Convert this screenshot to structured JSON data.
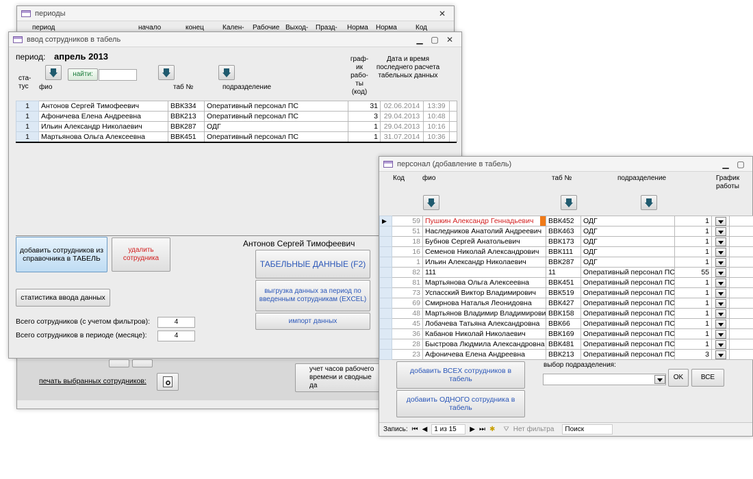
{
  "bg_window": {
    "title": "периоды",
    "headers": [
      "период",
      "начало",
      "конец",
      "Кален-",
      "Рабочие",
      "Выход-",
      "Празд-",
      "Норма",
      "Норма",
      "Код"
    ],
    "print_label": "печать выбранных сотрудников:",
    "hours_button": "учет часов рабочего времени и сводные да"
  },
  "main_window": {
    "title": "ввод сотрудников в табель",
    "period_label": "период:",
    "period_value": "апрель 2013",
    "status_header": "ста-\nтус",
    "fio_header": "фио",
    "find_button": "найти:",
    "find_value": "",
    "tab_header": "таб №",
    "dept_header": "подразделение",
    "schedule_header": "граф-\nик\nрабо-\nты\n(код)",
    "datetime_header": "Дата и время последнего расчета табельных данных",
    "rows": [
      {
        "status": "1",
        "fio": "Антонов Сергей Тимофеевич",
        "tab": "ВВК334",
        "dept": "Оперативный персонал ПС",
        "sched": "31",
        "date": "02.06.2014",
        "time": "13:39"
      },
      {
        "status": "1",
        "fio": "Афоничева Елена Андреевна",
        "tab": "ВВК213",
        "dept": "Оперативный персонал ПС",
        "sched": "3",
        "date": "29.04.2013",
        "time": "10:48"
      },
      {
        "status": "1",
        "fio": "Ильин Александр Николаевич",
        "tab": "ВВК287",
        "dept": "ОДГ",
        "sched": "1",
        "date": "29.04.2013",
        "time": "10:16"
      },
      {
        "status": "1",
        "fio": "Мартьянова Ольга Алексеевна",
        "tab": "ВВК451",
        "dept": "Оперативный персонал ПС",
        "sched": "1",
        "date": "31.07.2014",
        "time": "10:36"
      }
    ],
    "add_button": "добавить сотрудников из справочника в ТАБЕЛЬ",
    "delete_button": "удалить сотрудника",
    "current_employee": "Антонов Сергей Тимофеевич",
    "tabel_button": "ТАБЕЛЬНЫЕ ДАННЫЕ  (F2)",
    "export_button": "выгрузка данных за период по введенным сотрудникам (EXCEL)",
    "import_button": "импорт данных",
    "stats_button": "статистика ввода данных",
    "total_filtered_label": "Всего сотрудников (с учетом фильтров):",
    "total_filtered_value": "4",
    "total_period_label": "Всего сотрудников в периоде (месяце):",
    "total_period_value": "4"
  },
  "personnel_window": {
    "title": "персонал (добавление в табель)",
    "col_code": "Код",
    "col_fio": "фио",
    "col_tab": "таб №",
    "col_dept": "подразделение",
    "col_schedule": "График работы",
    "rows": [
      {
        "code": "59",
        "fio": "Пушкин Александр Геннадьевич",
        "tab": "ВВК452",
        "dept": "ОДГ",
        "sched": "1"
      },
      {
        "code": "51",
        "fio": "Наследников Анатолий Андреевич",
        "tab": "ВВК463",
        "dept": "ОДГ",
        "sched": "1"
      },
      {
        "code": "18",
        "fio": "Бубнов Сергей Анатольевич",
        "tab": "ВВК173",
        "dept": "ОДГ",
        "sched": "1"
      },
      {
        "code": "16",
        "fio": "Семенов Николай Александрович",
        "tab": "ВВК111",
        "dept": "ОДГ",
        "sched": "1"
      },
      {
        "code": "1",
        "fio": "Ильин Александр Николаевич",
        "tab": "ВВК287",
        "dept": "ОДГ",
        "sched": "1"
      },
      {
        "code": "82",
        "fio": "111",
        "tab": "11",
        "dept": "Оперативный персонал ПС",
        "sched": "55"
      },
      {
        "code": "81",
        "fio": "Мартьянова Ольга Алексеевна",
        "tab": "ВВК451",
        "dept": "Оперативный персонал ПС",
        "sched": "1"
      },
      {
        "code": "73",
        "fio": "Успасский Виктор Владимирович",
        "tab": "ВВК519",
        "dept": "Оперативный персонал ПС",
        "sched": "1"
      },
      {
        "code": "69",
        "fio": "Смирнова Наталья Леонидовна",
        "tab": "ВВК427",
        "dept": "Оперативный персонал ПС",
        "sched": "1"
      },
      {
        "code": "48",
        "fio": "Мартьянов Владимир Владимирович",
        "tab": "ВВК158",
        "dept": "Оперативный персонал ПС",
        "sched": "1"
      },
      {
        "code": "45",
        "fio": "Лобачева Татьяна Александровна",
        "tab": "ВВК66",
        "dept": "Оперативный персонал ПС",
        "sched": "1"
      },
      {
        "code": "36",
        "fio": "Кабанов Николай Николаевич",
        "tab": "ВВК169",
        "dept": "Оперативный персонал ПС",
        "sched": "1"
      },
      {
        "code": "28",
        "fio": "Быстрова Людмила Александровна",
        "tab": "ВВК481",
        "dept": "Оперативный персонал ПС",
        "sched": "1"
      },
      {
        "code": "23",
        "fio": "Афоничева Елена Андреевна",
        "tab": "ВВК213",
        "dept": "Оперативный персонал ПС",
        "sched": "3"
      }
    ],
    "add_all_button": "добавить ВСЕХ сотрудников  в табель",
    "add_one_button": "добавить ОДНОГО сотрудника  в табель",
    "dept_select_label": "выбор подразделения:",
    "ok_button": "OK",
    "all_button": "ВСЕ",
    "record_label": "Запись:",
    "record_value": "1 из 15",
    "no_filter": "Нет фильтра",
    "search": "Поиск"
  },
  "colors": {
    "selected_col": "#dde9f5",
    "add_button_bg": "#cfe6f8",
    "delete_text": "#d21f1f",
    "blue_text": "#2a56b8",
    "current_cell": "#f07a18"
  }
}
